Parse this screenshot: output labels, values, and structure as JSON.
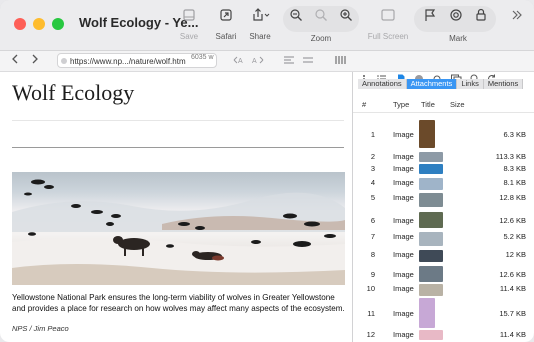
{
  "window": {
    "title": "Wolf Ecology - Ye..."
  },
  "toolbar": {
    "save_label": "Save",
    "safari_label": "Safari",
    "share_label": "Share",
    "zoom_label": "Zoom",
    "fullscreen_label": "Full Screen",
    "mark_label": "Mark"
  },
  "navbar": {
    "url": "https://www.np.../nature/wolf.htm",
    "size_text": "6035 w"
  },
  "article": {
    "heading": "Wolf Ecology",
    "caption": "Yellowstone National Park ensures the long-term viability of wolves in Greater Yellowstone and provides a place for research on how wolves may affect many aspects of the ecosystem.",
    "credit": "NPS / Jim Peaco"
  },
  "panel": {
    "tabs": [
      {
        "label": "Annotations",
        "active": false
      },
      {
        "label": "Attachments",
        "active": true
      },
      {
        "label": "Links",
        "active": false
      },
      {
        "label": "Mentions",
        "active": false
      }
    ],
    "columns": {
      "num": "#",
      "type": "Type",
      "title": "Title",
      "size": "Size"
    },
    "rows": [
      {
        "num": "1",
        "type": "Image",
        "size": "6.3 KB",
        "color": "#6b4a2a"
      },
      {
        "num": "2",
        "type": "Image",
        "size": "113.3 KB",
        "color": "#8d9aa6"
      },
      {
        "num": "3",
        "type": "Image",
        "size": "8.3 KB",
        "color": "#2e7fc1"
      },
      {
        "num": "4",
        "type": "Image",
        "size": "8.1 KB",
        "color": "#9fb4c9"
      },
      {
        "num": "5",
        "type": "Image",
        "size": "12.8 KB",
        "color": "#7e8c93"
      },
      {
        "num": "6",
        "type": "Image",
        "size": "12.6 KB",
        "color": "#5f6b52"
      },
      {
        "num": "7",
        "type": "Image",
        "size": "5.2 KB",
        "color": "#a8b4be"
      },
      {
        "num": "8",
        "type": "Image",
        "size": "12 KB",
        "color": "#3f4a57"
      },
      {
        "num": "9",
        "type": "Image",
        "size": "12.6 KB",
        "color": "#6c7a86"
      },
      {
        "num": "10",
        "type": "Image",
        "size": "11.4 KB",
        "color": "#b9b2a5"
      },
      {
        "num": "11",
        "type": "Image",
        "size": "15.7 KB",
        "color": "#c7a8d6"
      },
      {
        "num": "12",
        "type": "Image",
        "size": "11.4 KB",
        "color": "#e8b9c6"
      }
    ]
  }
}
